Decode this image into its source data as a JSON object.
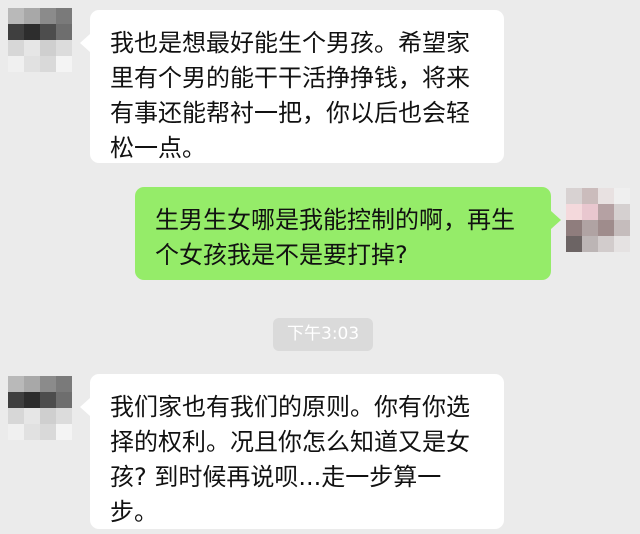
{
  "chat": {
    "messages": [
      {
        "sender": "contact",
        "lines": [
          "我也是想最好能生个男孩。希望家",
          "里有个男的能干干活挣挣钱，将来",
          "有事还能帮衬一把，你以后也会轻",
          "松一点。"
        ]
      },
      {
        "sender": "me",
        "lines": [
          "生男生女哪是我能控制的啊，再生",
          "个女孩我是不是要打掉?"
        ]
      },
      {
        "sender": "contact",
        "lines": [
          "我们家也有我们的原则。你有你选",
          "择的权利。况且你怎么知道又是女",
          "孩? 到时候再说呗...走一步算一",
          "步。"
        ]
      }
    ],
    "timestamp": "下午3:03"
  },
  "colors": {
    "background": "#ebebeb",
    "incoming_bubble": "#ffffff",
    "outgoing_bubble": "#95ec69",
    "timestamp_bg": "#dadada",
    "timestamp_text": "#ffffff"
  },
  "avatars": {
    "contact_pixels": [
      "#b9b9b9",
      "#a8a8a8",
      "#8b8b8b",
      "#7a7a7a",
      "#3f3f3f",
      "#2d2d2d",
      "#4d4d4d",
      "#6e6e6e",
      "#d7d7d7",
      "#e6e6e6",
      "#cfcfcf",
      "#dcdcdc",
      "#f0f0f0",
      "#e1e1e1",
      "#d9d9d9",
      "#f4f4f4"
    ],
    "me_pixels": [
      "#d8d2d2",
      "#cbbcbc",
      "#e8e1e1",
      "#efefef",
      "#f4d9dc",
      "#e9c7cf",
      "#b5a1a3",
      "#d5d0d0",
      "#8f7d7d",
      "#b0a3a3",
      "#9f8c8c",
      "#c5bcbc",
      "#6c6464",
      "#bcb5b5",
      "#d2cccc",
      "#e5e2e2"
    ]
  }
}
